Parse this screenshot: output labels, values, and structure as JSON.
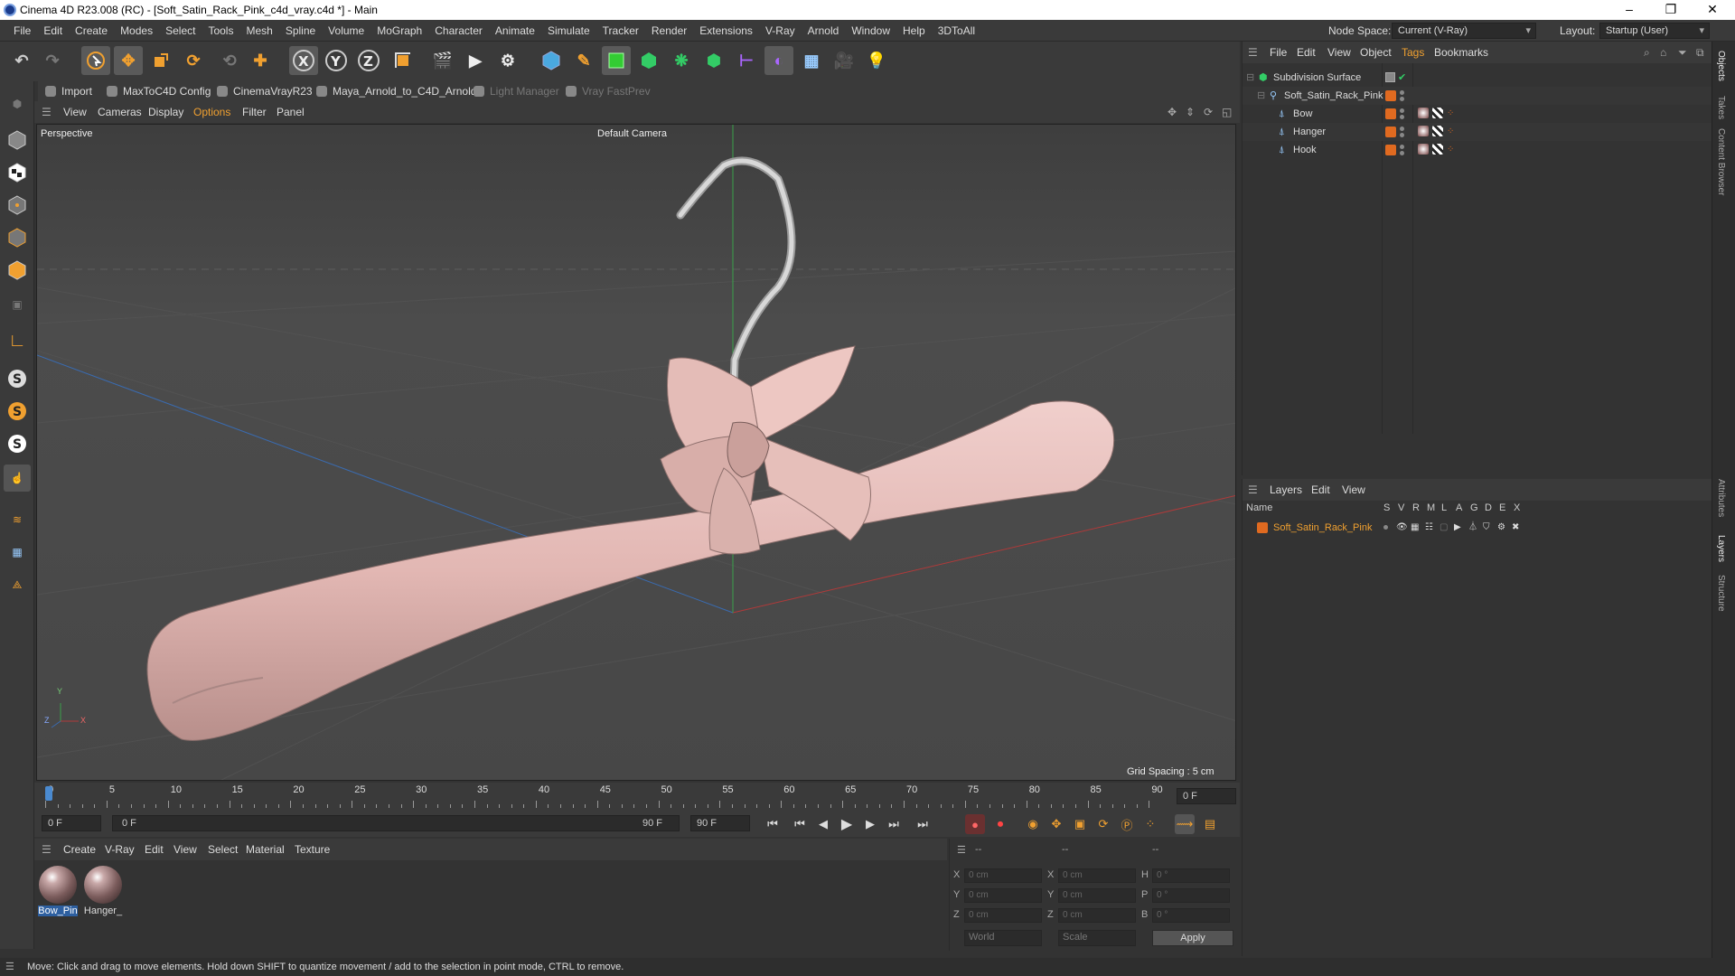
{
  "window": {
    "title": "Cinema 4D R23.008 (RC) - [Soft_Satin_Rack_Pink_c4d_vray.c4d *] - Main",
    "controls": [
      "–",
      "❐",
      "✕"
    ]
  },
  "menu": [
    "File",
    "Edit",
    "Create",
    "Modes",
    "Select",
    "Tools",
    "Mesh",
    "Spline",
    "Volume",
    "MoGraph",
    "Character",
    "Animate",
    "Simulate",
    "Tracker",
    "Render",
    "Extensions",
    "V-Ray",
    "Arnold",
    "Window",
    "Help",
    "3DToAll"
  ],
  "node_space": {
    "label": "Node Space:",
    "value": "Current (V-Ray)"
  },
  "layout": {
    "label": "Layout:",
    "value": "Startup (User)"
  },
  "plugins": [
    {
      "label": "Import",
      "enabled": true
    },
    {
      "label": "MaxToC4D Config",
      "enabled": true
    },
    {
      "label": "CinemaVrayR23",
      "enabled": true
    },
    {
      "label": "Maya_Arnold_to_C4D_Arnold",
      "enabled": true
    },
    {
      "label": "Light Manager",
      "enabled": false
    },
    {
      "label": "Vray FastPrev",
      "enabled": false
    }
  ],
  "viewport": {
    "menu": [
      "View",
      "Cameras",
      "Display",
      "Options",
      "Filter",
      "Panel"
    ],
    "label": "Perspective",
    "camera": "Default Camera",
    "grid_spacing": "Grid Spacing : 5 cm",
    "axis": {
      "y": "Y",
      "x": "X",
      "z": "Z"
    }
  },
  "timeline": {
    "ticks": [
      "0",
      "5",
      "10",
      "15",
      "20",
      "25",
      "30",
      "35",
      "40",
      "45",
      "50",
      "55",
      "60",
      "65",
      "70",
      "75",
      "80",
      "85",
      "90"
    ],
    "current_frame": "0 F",
    "start": "0 F",
    "range_start": "0 F",
    "range_end": "90 F",
    "end": "90 F"
  },
  "materials": {
    "menu": [
      "Create",
      "V-Ray",
      "Edit",
      "View",
      "Select",
      "Material",
      "Texture"
    ],
    "items": [
      "Bow_Pin",
      "Hanger_"
    ]
  },
  "coordinates": {
    "headers": [
      "--",
      "--",
      "--"
    ],
    "rows": [
      {
        "a": "X",
        "av": "0 cm",
        "b": "X",
        "bv": "0 cm",
        "c": "H",
        "cv": "0 °"
      },
      {
        "a": "Y",
        "av": "0 cm",
        "b": "Y",
        "bv": "0 cm",
        "c": "P",
        "cv": "0 °"
      },
      {
        "a": "Z",
        "av": "0 cm",
        "b": "Z",
        "bv": "0 cm",
        "c": "B",
        "cv": "0 °"
      }
    ],
    "mode1": "World",
    "mode2": "Scale",
    "apply": "Apply"
  },
  "objects": {
    "menu": [
      "File",
      "Edit",
      "View",
      "Object",
      "Tags",
      "Bookmarks"
    ],
    "tree": [
      {
        "name": "Subdivision Surface",
        "depth": 0
      },
      {
        "name": "Soft_Satin_Rack_Pink",
        "depth": 1
      },
      {
        "name": "Bow",
        "depth": 2
      },
      {
        "name": "Hanger",
        "depth": 2
      },
      {
        "name": "Hook",
        "depth": 2
      }
    ]
  },
  "layers": {
    "menu": [
      "Layers",
      "Edit",
      "View"
    ],
    "header_name": "Name",
    "columns": [
      "S",
      "V",
      "R",
      "M",
      "L",
      "A",
      "G",
      "D",
      "E",
      "X"
    ],
    "items": [
      "Soft_Satin_Rack_Pink"
    ]
  },
  "side_tabs": [
    "Objects",
    "Takes",
    "Content Browser",
    "Attributes",
    "Layers",
    "Structure"
  ],
  "status": "Move: Click and drag to move elements. Hold down SHIFT to quantize movement / add to the selection in point mode, CTRL to remove.",
  "colors": {
    "accent": "#f0a030",
    "layer_orange": "#e06a20",
    "object": "#ecc0bd"
  }
}
